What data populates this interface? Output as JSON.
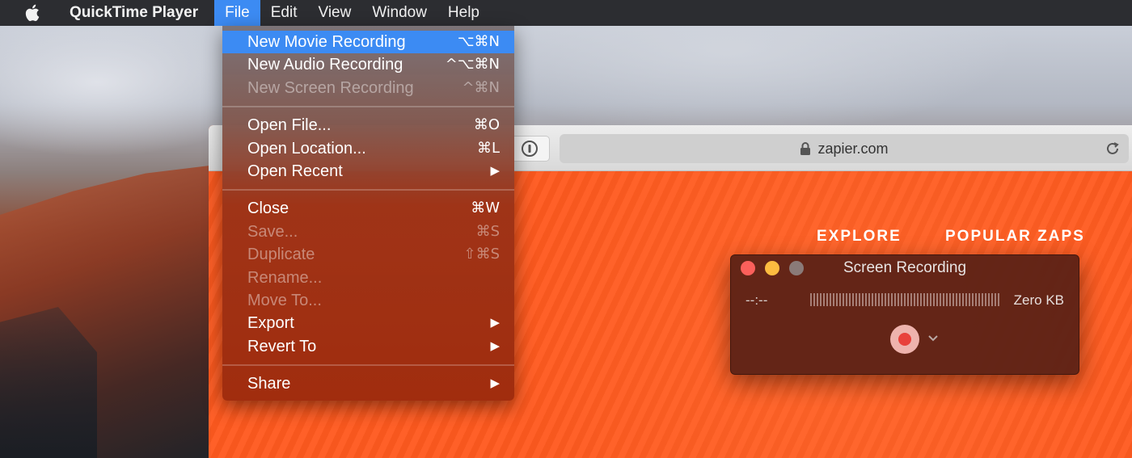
{
  "menubar": {
    "app_name": "QuickTime Player",
    "items": [
      {
        "label": "File",
        "active": true
      },
      {
        "label": "Edit"
      },
      {
        "label": "View"
      },
      {
        "label": "Window"
      },
      {
        "label": "Help"
      }
    ]
  },
  "file_menu": {
    "groups": [
      [
        {
          "label": "New Movie Recording",
          "shortcut": "⌥⌘N",
          "highlighted": true
        },
        {
          "label": "New Audio Recording",
          "shortcut": "^⌥⌘N"
        },
        {
          "label": "New Screen Recording",
          "shortcut": "^⌘N",
          "disabled": true
        }
      ],
      [
        {
          "label": "Open File...",
          "shortcut": "⌘O"
        },
        {
          "label": "Open Location...",
          "shortcut": "⌘L"
        },
        {
          "label": "Open Recent",
          "shortcut": "▶"
        }
      ],
      [
        {
          "label": "Close",
          "shortcut": "⌘W"
        },
        {
          "label": "Save...",
          "shortcut": "⌘S",
          "disabled": true
        },
        {
          "label": "Duplicate",
          "shortcut": "⇧⌘S",
          "disabled": true
        },
        {
          "label": "Rename...",
          "shortcut": "",
          "disabled": true
        },
        {
          "label": "Move To...",
          "shortcut": "",
          "disabled": true
        },
        {
          "label": "Export",
          "shortcut": "▶"
        },
        {
          "label": "Revert To",
          "shortcut": "▶"
        }
      ],
      [
        {
          "label": "Share",
          "shortcut": "▶"
        }
      ]
    ]
  },
  "browser": {
    "address": "zapier.com",
    "nav": [
      {
        "label": "EXPLORE"
      },
      {
        "label": "POPULAR ZAPS"
      }
    ]
  },
  "recorder": {
    "title": "Screen Recording",
    "time": "--:--",
    "size": "Zero KB"
  },
  "colors": {
    "menu_highlight": "#3c8bf3",
    "brand_orange": "#ff5a1f",
    "record_red": "#e8413b"
  }
}
